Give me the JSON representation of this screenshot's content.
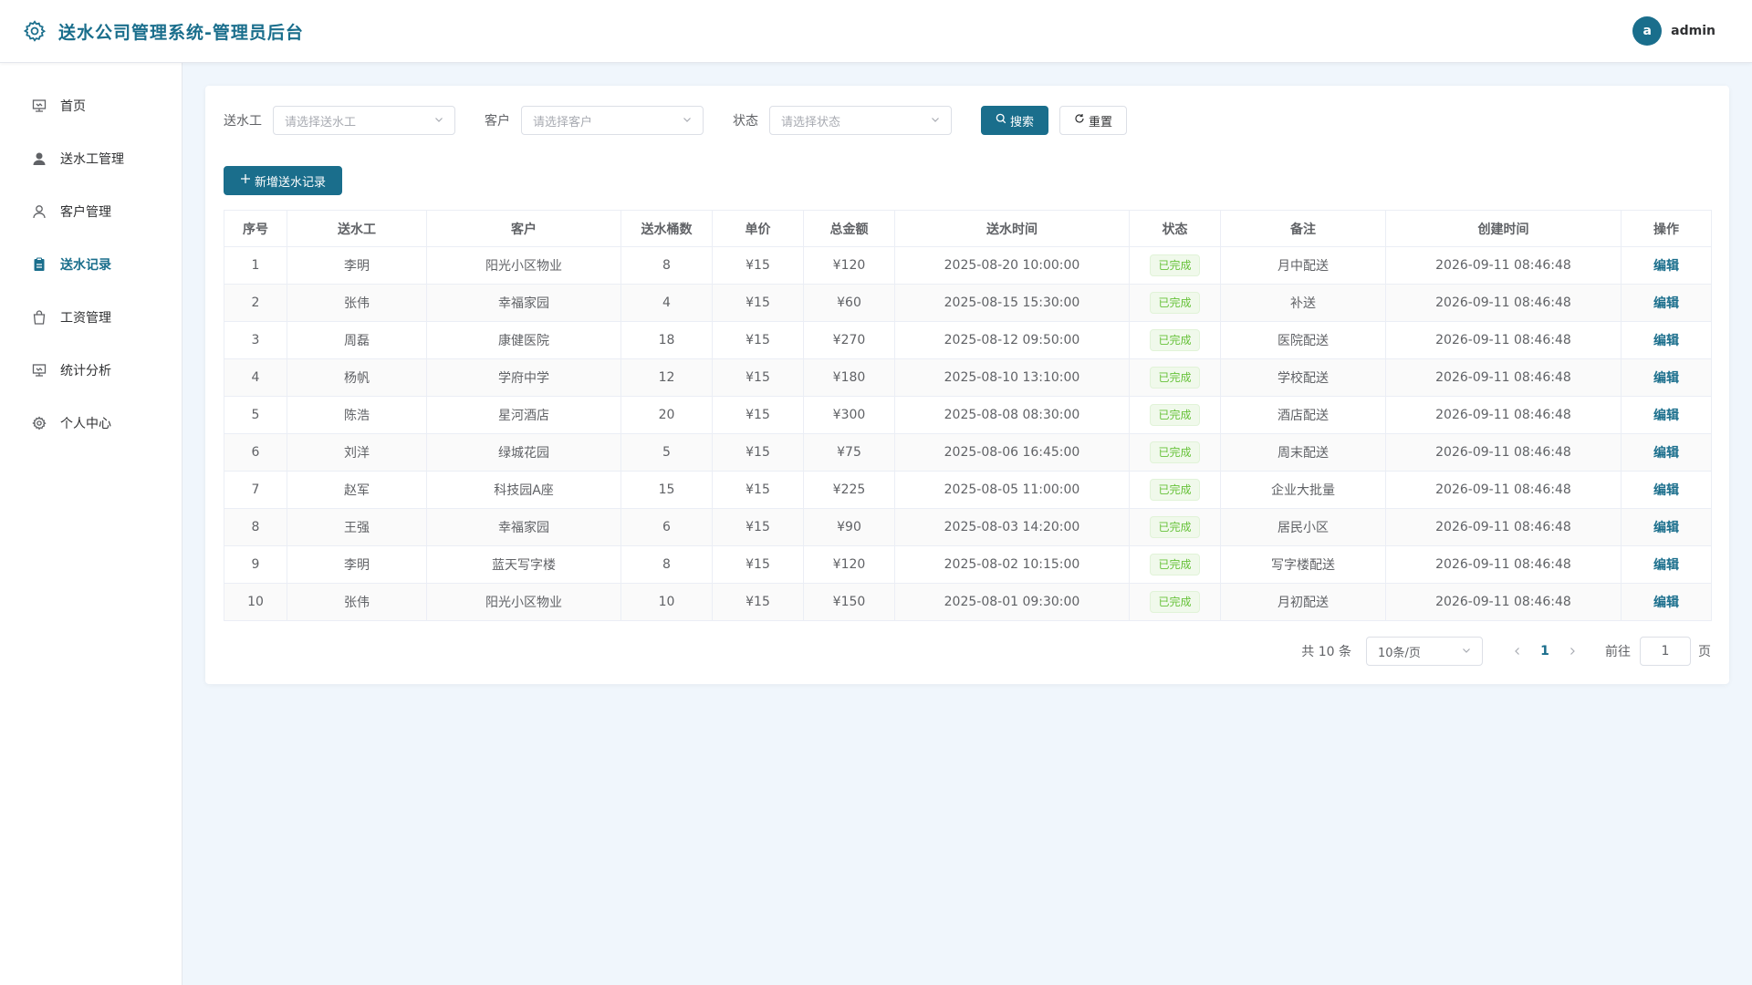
{
  "app": {
    "title": "送水公司管理系统-管理员后台",
    "accent_color": "#1a6e8c"
  },
  "user": {
    "avatar_letter": "a",
    "name": "admin"
  },
  "sidebar": {
    "items": [
      {
        "label": "首页",
        "icon": "dashboard-icon"
      },
      {
        "label": "送水工管理",
        "icon": "user-filled-icon"
      },
      {
        "label": "客户管理",
        "icon": "user-icon"
      },
      {
        "label": "送水记录",
        "icon": "document-icon",
        "active": true
      },
      {
        "label": "工资管理",
        "icon": "bag-icon"
      },
      {
        "label": "统计分析",
        "icon": "chart-icon"
      },
      {
        "label": "个人中心",
        "icon": "gear-icon"
      }
    ]
  },
  "filters": {
    "worker_label": "送水工",
    "worker_placeholder": "请选择送水工",
    "customer_label": "客户",
    "customer_placeholder": "请选择客户",
    "status_label": "状态",
    "status_placeholder": "请选择状态",
    "search_label": "搜索",
    "reset_label": "重置"
  },
  "add_button_label": "新增送水记录",
  "table": {
    "columns": [
      "序号",
      "送水工",
      "客户",
      "送水桶数",
      "单价",
      "总金额",
      "送水时间",
      "状态",
      "备注",
      "创建时间",
      "操作"
    ],
    "rows": [
      [
        "1",
        "李明",
        "阳光小区物业",
        "8",
        "¥15",
        "¥120",
        "2025-08-20 10:00:00",
        "已完成",
        "月中配送",
        "2026-09-11 08:46:48",
        "编辑"
      ],
      [
        "2",
        "张伟",
        "幸福家园",
        "4",
        "¥15",
        "¥60",
        "2025-08-15 15:30:00",
        "已完成",
        "补送",
        "2026-09-11 08:46:48",
        "编辑"
      ],
      [
        "3",
        "周磊",
        "康健医院",
        "18",
        "¥15",
        "¥270",
        "2025-08-12 09:50:00",
        "已完成",
        "医院配送",
        "2026-09-11 08:46:48",
        "编辑"
      ],
      [
        "4",
        "杨帆",
        "学府中学",
        "12",
        "¥15",
        "¥180",
        "2025-08-10 13:10:00",
        "已完成",
        "学校配送",
        "2026-09-11 08:46:48",
        "编辑"
      ],
      [
        "5",
        "陈浩",
        "星河酒店",
        "20",
        "¥15",
        "¥300",
        "2025-08-08 08:30:00",
        "已完成",
        "酒店配送",
        "2026-09-11 08:46:48",
        "编辑"
      ],
      [
        "6",
        "刘洋",
        "绿城花园",
        "5",
        "¥15",
        "¥75",
        "2025-08-06 16:45:00",
        "已完成",
        "周末配送",
        "2026-09-11 08:46:48",
        "编辑"
      ],
      [
        "7",
        "赵军",
        "科技园A座",
        "15",
        "¥15",
        "¥225",
        "2025-08-05 11:00:00",
        "已完成",
        "企业大批量",
        "2026-09-11 08:46:48",
        "编辑"
      ],
      [
        "8",
        "王强",
        "幸福家园",
        "6",
        "¥15",
        "¥90",
        "2025-08-03 14:20:00",
        "已完成",
        "居民小区",
        "2026-09-11 08:46:48",
        "编辑"
      ],
      [
        "9",
        "李明",
        "蓝天写字楼",
        "8",
        "¥15",
        "¥120",
        "2025-08-02 10:15:00",
        "已完成",
        "写字楼配送",
        "2026-09-11 08:46:48",
        "编辑"
      ],
      [
        "10",
        "张伟",
        "阳光小区物业",
        "10",
        "¥15",
        "¥150",
        "2025-08-01 09:30:00",
        "已完成",
        "月初配送",
        "2026-09-11 08:46:48",
        "编辑"
      ]
    ]
  },
  "pagination": {
    "total_text": "共 10 条",
    "page_size": "10条/页",
    "current_page": "1",
    "goto_label": "前往",
    "goto_value": "1",
    "page_suffix": "页"
  }
}
